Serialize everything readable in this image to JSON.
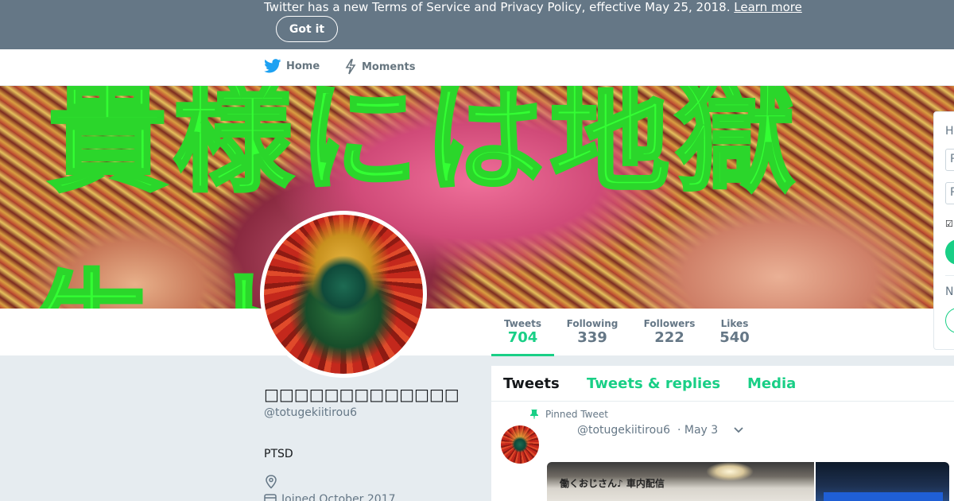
{
  "notice": {
    "text": "Twitter has a new Terms of Service and Privacy Policy, effective May 25, 2018.",
    "link": "Learn more",
    "dismiss_label": "Got it"
  },
  "nav": {
    "items": [
      {
        "label": "Home",
        "icon": "twitter-bird-icon"
      },
      {
        "label": "Moments",
        "icon": "lightning-icon"
      }
    ]
  },
  "header": {
    "overlay_text_top": "貴様には地獄",
    "overlay_text_bottom": "生ト"
  },
  "stats": [
    {
      "label": "Tweets",
      "value": "704",
      "active": true
    },
    {
      "label": "Following",
      "value": "339",
      "active": false
    },
    {
      "label": "Followers",
      "value": "222",
      "active": false
    },
    {
      "label": "Likes",
      "value": "540",
      "active": false
    }
  ],
  "profile": {
    "display_name": "□□□□□□□□□□□□□",
    "handle": "@totugekiitirou6",
    "bio": "PTSD",
    "joined": "Joined October 2017"
  },
  "timeline": {
    "tabs": [
      {
        "label": "Tweets",
        "active": true
      },
      {
        "label": "Tweets & replies",
        "active": false
      },
      {
        "label": "Media",
        "active": false
      }
    ],
    "pinned_label": "Pinned Tweet",
    "tweet": {
      "handle": "@totugekiitirou6",
      "date": "· May 3",
      "media_caption": "働くおじさん♪ 車内配信"
    }
  },
  "login_card": {
    "title_fragment": "H",
    "field1_fragment": "P",
    "field2_fragment": "P",
    "new_fragment": "N"
  },
  "colors": {
    "accent": "#19cf86",
    "banner_bg": "#657786",
    "page_bg": "#e6ecf0"
  }
}
